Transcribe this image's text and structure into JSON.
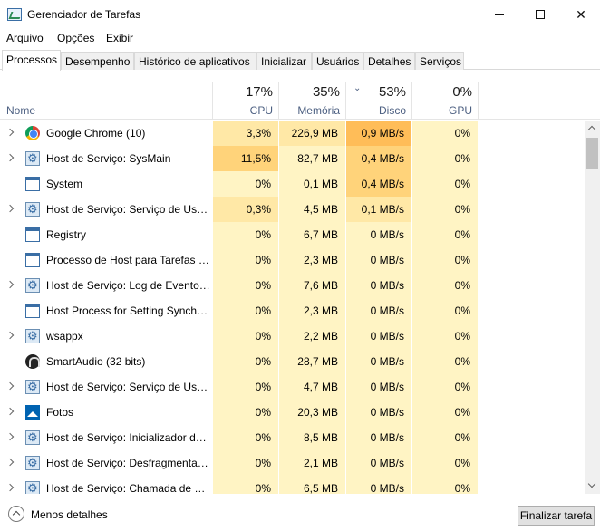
{
  "window": {
    "title": "Gerenciador de Tarefas",
    "controls": {
      "minimize_icon": "minimize-icon",
      "maximize_icon": "maximize-icon",
      "close_icon": "close-icon",
      "close_glyph": "✕"
    }
  },
  "menu": [
    {
      "label": "Arquivo"
    },
    {
      "label": "Opções"
    },
    {
      "label": "Exibir"
    }
  ],
  "tabs": [
    {
      "label": "Processos",
      "active": true
    },
    {
      "label": "Desempenho"
    },
    {
      "label": "Histórico de aplicativos"
    },
    {
      "label": "Inicializar"
    },
    {
      "label": "Usuários"
    },
    {
      "label": "Detalhes"
    },
    {
      "label": "Serviços"
    }
  ],
  "columns": {
    "name": {
      "label": "Nome"
    },
    "cpu": {
      "percent": "17%",
      "label": "CPU"
    },
    "memory": {
      "percent": "35%",
      "label": "Memória"
    },
    "disk": {
      "percent": "53%",
      "label": "Disco",
      "sorted": "descending"
    },
    "gpu": {
      "percent": "0%",
      "label": "GPU"
    }
  },
  "heat_colors": {
    "light": "#fff4c4",
    "medium": "#ffe8a6",
    "strong": "#ffd37a",
    "hot": "#ffbd58"
  },
  "processes": [
    {
      "name": "Google Chrome (10)",
      "icon": "chrome-icon",
      "expandable": true,
      "cpu": "3,3%",
      "memory": "226,9 MB",
      "disk": "0,9 MB/s",
      "gpu": "0%",
      "heat": {
        "cpu": "medium",
        "memory": "medium",
        "disk": "hot",
        "gpu": "light"
      }
    },
    {
      "name": "Host de Serviço: SysMain",
      "icon": "gear-icon",
      "expandable": true,
      "cpu": "11,5%",
      "memory": "82,7 MB",
      "disk": "0,4 MB/s",
      "gpu": "0%",
      "heat": {
        "cpu": "strong",
        "memory": "light",
        "disk": "strong",
        "gpu": "light"
      }
    },
    {
      "name": "System",
      "icon": "window-icon",
      "expandable": false,
      "cpu": "0%",
      "memory": "0,1 MB",
      "disk": "0,4 MB/s",
      "gpu": "0%",
      "heat": {
        "cpu": "light",
        "memory": "light",
        "disk": "strong",
        "gpu": "light"
      }
    },
    {
      "name": "Host de Serviço: Serviço de Usuário...",
      "icon": "gear-icon",
      "expandable": true,
      "cpu": "0,3%",
      "memory": "4,5 MB",
      "disk": "0,1 MB/s",
      "gpu": "0%",
      "heat": {
        "cpu": "medium",
        "memory": "light",
        "disk": "medium",
        "gpu": "light"
      }
    },
    {
      "name": "Registry",
      "icon": "window-icon",
      "expandable": false,
      "cpu": "0%",
      "memory": "6,7 MB",
      "disk": "0 MB/s",
      "gpu": "0%",
      "heat": {
        "cpu": "light",
        "memory": "light",
        "disk": "light",
        "gpu": "light"
      }
    },
    {
      "name": "Processo de Host para Tarefas do Windows",
      "icon": "window-icon",
      "expandable": false,
      "cpu": "0%",
      "memory": "2,3 MB",
      "disk": "0 MB/s",
      "gpu": "0%",
      "heat": {
        "cpu": "light",
        "memory": "light",
        "disk": "light",
        "gpu": "light"
      }
    },
    {
      "name": "Host de Serviço: Log de Eventos do Windows",
      "icon": "gear-icon",
      "expandable": true,
      "cpu": "0%",
      "memory": "7,6 MB",
      "disk": "0 MB/s",
      "gpu": "0%",
      "heat": {
        "cpu": "light",
        "memory": "light",
        "disk": "light",
        "gpu": "light"
      }
    },
    {
      "name": "Host Process for Setting Synchronization",
      "icon": "window-icon",
      "expandable": false,
      "cpu": "0%",
      "memory": "2,3 MB",
      "disk": "0 MB/s",
      "gpu": "0%",
      "heat": {
        "cpu": "light",
        "memory": "light",
        "disk": "light",
        "gpu": "light"
      }
    },
    {
      "name": "wsappx",
      "icon": "gear-icon",
      "expandable": true,
      "cpu": "0%",
      "memory": "2,2 MB",
      "disk": "0 MB/s",
      "gpu": "0%",
      "heat": {
        "cpu": "light",
        "memory": "light",
        "disk": "light",
        "gpu": "light"
      }
    },
    {
      "name": "SmartAudio (32 bits)",
      "icon": "audio-icon",
      "expandable": false,
      "cpu": "0%",
      "memory": "28,7 MB",
      "disk": "0 MB/s",
      "gpu": "0%",
      "heat": {
        "cpu": "light",
        "memory": "light",
        "disk": "light",
        "gpu": "light"
      }
    },
    {
      "name": "Host de Serviço: Serviço de Usuário...",
      "icon": "gear-icon",
      "expandable": true,
      "cpu": "0%",
      "memory": "4,7 MB",
      "disk": "0 MB/s",
      "gpu": "0%",
      "heat": {
        "cpu": "light",
        "memory": "light",
        "disk": "light",
        "gpu": "light"
      }
    },
    {
      "name": "Fotos",
      "icon": "photos-icon",
      "expandable": true,
      "cpu": "0%",
      "memory": "20,3 MB",
      "disk": "0 MB/s",
      "gpu": "0%",
      "heat": {
        "cpu": "light",
        "memory": "light",
        "disk": "light",
        "gpu": "light"
      }
    },
    {
      "name": "Host de Serviço: Inicializador de Processo de Servidor DCOM",
      "icon": "gear-icon",
      "expandable": true,
      "cpu": "0%",
      "memory": "8,5 MB",
      "disk": "0 MB/s",
      "gpu": "0%",
      "heat": {
        "cpu": "light",
        "memory": "light",
        "disk": "light",
        "gpu": "light"
      }
    },
    {
      "name": "Host de Serviço: Desfragmentação",
      "icon": "gear-icon",
      "expandable": true,
      "cpu": "0%",
      "memory": "2,1 MB",
      "disk": "0 MB/s",
      "gpu": "0%",
      "heat": {
        "cpu": "light",
        "memory": "light",
        "disk": "light",
        "gpu": "light"
      }
    },
    {
      "name": "Host de Serviço: Chamada de Procedimento Remoto",
      "icon": "gear-icon",
      "expandable": true,
      "cpu": "0%",
      "memory": "6,5 MB",
      "disk": "0 MB/s",
      "gpu": "0%",
      "heat": {
        "cpu": "light",
        "memory": "light",
        "disk": "light",
        "gpu": "light"
      }
    }
  ],
  "footer": {
    "less_details_label": "Menos detalhes",
    "end_task_label": "Finalizar tarefa"
  }
}
